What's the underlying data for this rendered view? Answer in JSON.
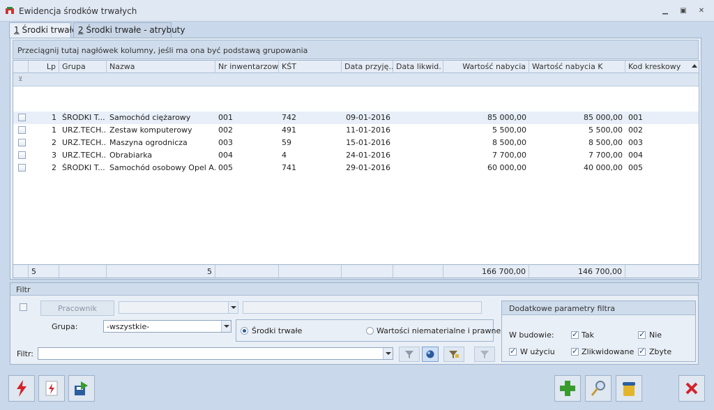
{
  "window": {
    "title": "Ewidencja środków trwałych"
  },
  "tabs": [
    {
      "key": "1",
      "label": " Środki trwałe",
      "active": true
    },
    {
      "key": "2",
      "label": " Środki trwałe - atrybuty",
      "active": false
    }
  ],
  "grid": {
    "group_hint": "Przeciągnij tutaj nagłówek kolumny, jeśli ma ona być podstawą grupowania",
    "columns": [
      "Lp",
      "Grupa",
      "Nazwa",
      "Nr inwentarzowy",
      "KŚT",
      "Data przyję...",
      "Data likwid.",
      "Wartość nabycia",
      "Wartość nabycia K",
      "Kod kreskowy"
    ],
    "rows": [
      {
        "lp": "1",
        "grupa": "ŚRODKI T...",
        "nazwa": "Samochód ciężarowy",
        "nr": "001",
        "kst": "742",
        "data_przyj": "09-01-2016",
        "data_likw": "",
        "wartosc": "85 000,00",
        "wartosc_k": "85 000,00",
        "kod": "001"
      },
      {
        "lp": "1",
        "grupa": "URZ.TECH...",
        "nazwa": "Zestaw komputerowy",
        "nr": "002",
        "kst": "491",
        "data_przyj": "11-01-2016",
        "data_likw": "",
        "wartosc": "5 500,00",
        "wartosc_k": "5 500,00",
        "kod": "002"
      },
      {
        "lp": "2",
        "grupa": "URZ.TECH...",
        "nazwa": "Maszyna ogrodnicza",
        "nr": "003",
        "kst": "59",
        "data_przyj": "15-01-2016",
        "data_likw": "",
        "wartosc": "8 500,00",
        "wartosc_k": "8 500,00",
        "kod": "003"
      },
      {
        "lp": "3",
        "grupa": "URZ.TECH...",
        "nazwa": "Obrabiarka",
        "nr": "004",
        "kst": "4",
        "data_przyj": "24-01-2016",
        "data_likw": "",
        "wartosc": "7 700,00",
        "wartosc_k": "7 700,00",
        "kod": "004"
      },
      {
        "lp": "2",
        "grupa": "ŚRODKI T...",
        "nazwa": "Samochód osobowy Opel A...",
        "nr": "005",
        "kst": "741",
        "data_przyj": "29-01-2016",
        "data_likw": "",
        "wartosc": "60 000,00",
        "wartosc_k": "40 000,00",
        "kod": "005"
      }
    ],
    "footer": {
      "lp_count": "5",
      "nazwa_count": "5",
      "wartosc_sum": "166 700,00",
      "wartosc_k_sum": "146 700,00"
    }
  },
  "filter": {
    "legend": "Filtr",
    "pracownik_label": "Pracownik",
    "grupa_label": "Grupa:",
    "grupa_value": "-wszystkie-",
    "radio_srodki": "Środki trwałe",
    "radio_wartosci": "Wartości niematerialne i prawne",
    "filter_label": "Filtr:",
    "filter_value": "",
    "params_title": "Dodatkowe parametry filtra",
    "w_budowie_label": "W budowie:",
    "tak": "Tak",
    "nie": "Nie",
    "w_uzyciu": "W użyciu",
    "zlikwidowane": "Zlikwidowane",
    "zbyte": "Zbyte"
  },
  "colors": {
    "accent_red": "#d3232a",
    "accent_green": "#3a9b2d",
    "panel": "#e9eff6",
    "border": "#9db2cc"
  }
}
